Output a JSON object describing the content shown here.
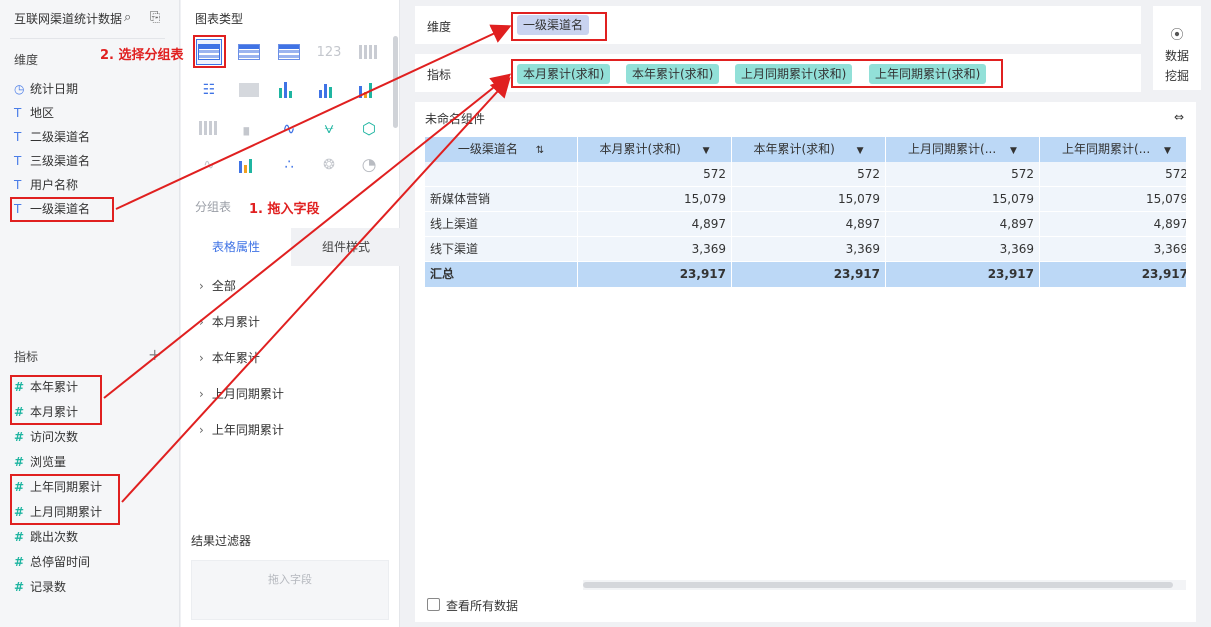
{
  "datasource": {
    "title": "互联网渠道统计数据",
    "icons": [
      "search-icon",
      "switch-icon"
    ]
  },
  "dimensions": {
    "label": "维度",
    "items": [
      {
        "icon": "clock-icon",
        "label": "统计日期"
      },
      {
        "icon": "text-icon",
        "glyph": "T",
        "label": "地区"
      },
      {
        "icon": "text-icon",
        "glyph": "T",
        "label": "二级渠道名"
      },
      {
        "icon": "text-icon",
        "glyph": "T",
        "label": "三级渠道名"
      },
      {
        "icon": "text-icon",
        "glyph": "T",
        "label": "用户名称"
      },
      {
        "icon": "text-icon",
        "glyph": "T",
        "label": "一级渠道名"
      }
    ]
  },
  "measures": {
    "label": "指标",
    "add": "+",
    "items": [
      {
        "glyph": "#",
        "label": "本年累计"
      },
      {
        "glyph": "#",
        "label": "本月累计"
      },
      {
        "glyph": "#",
        "label": "访问次数"
      },
      {
        "glyph": "#",
        "label": "浏览量"
      },
      {
        "glyph": "#",
        "label": "上年同期累计"
      },
      {
        "glyph": "#",
        "label": "上月同期累计"
      },
      {
        "glyph": "#",
        "label": "跳出次数"
      },
      {
        "glyph": "#",
        "label": "总停留时间"
      },
      {
        "glyph": "#",
        "label": "记录数"
      }
    ]
  },
  "chart_types": {
    "title": "图表类型",
    "icon_123": "123",
    "selected_label": "分组表",
    "tabs": [
      "表格属性",
      "组件样式"
    ],
    "properties": [
      "全部",
      "本月累计",
      "本年累计",
      "上月同期累计",
      "上年同期累计"
    ],
    "filter_title": "结果过滤器",
    "filter_placeholder": "拖入字段"
  },
  "shelves": {
    "dimension_label": "维度",
    "dimension_pills": [
      "一级渠道名"
    ],
    "measure_label": "指标",
    "measure_pills": [
      "本月累计(求和)",
      "本年累计(求和)",
      "上月同期累计(求和)",
      "上年同期累计(求和)"
    ],
    "mine_label_1": "数据",
    "mine_label_2": "挖掘"
  },
  "component": {
    "title": "未命名组件",
    "headers": [
      "一级渠道名",
      "本月累计(求和)",
      "本年累计(求和)",
      "上月同期累计(...",
      "上年同期累计(..."
    ],
    "rows": [
      [
        "",
        "572",
        "572",
        "572",
        "572"
      ],
      [
        "新媒体营销",
        "15,079",
        "15,079",
        "15,079",
        "15,079"
      ],
      [
        "线上渠道",
        "4,897",
        "4,897",
        "4,897",
        "4,897"
      ],
      [
        "线下渠道",
        "3,369",
        "3,369",
        "3,369",
        "3,369"
      ]
    ],
    "total": [
      "汇总",
      "23,917",
      "23,917",
      "23,917",
      "23,917"
    ],
    "show_all_label": "查看所有数据"
  },
  "annotations": {
    "step1": "1. 拖入字段",
    "step2": "2. 选择分组表"
  },
  "colors": {
    "accent": "#3f73e5",
    "measure": "#1fb5a1",
    "annotation": "#e02020"
  }
}
